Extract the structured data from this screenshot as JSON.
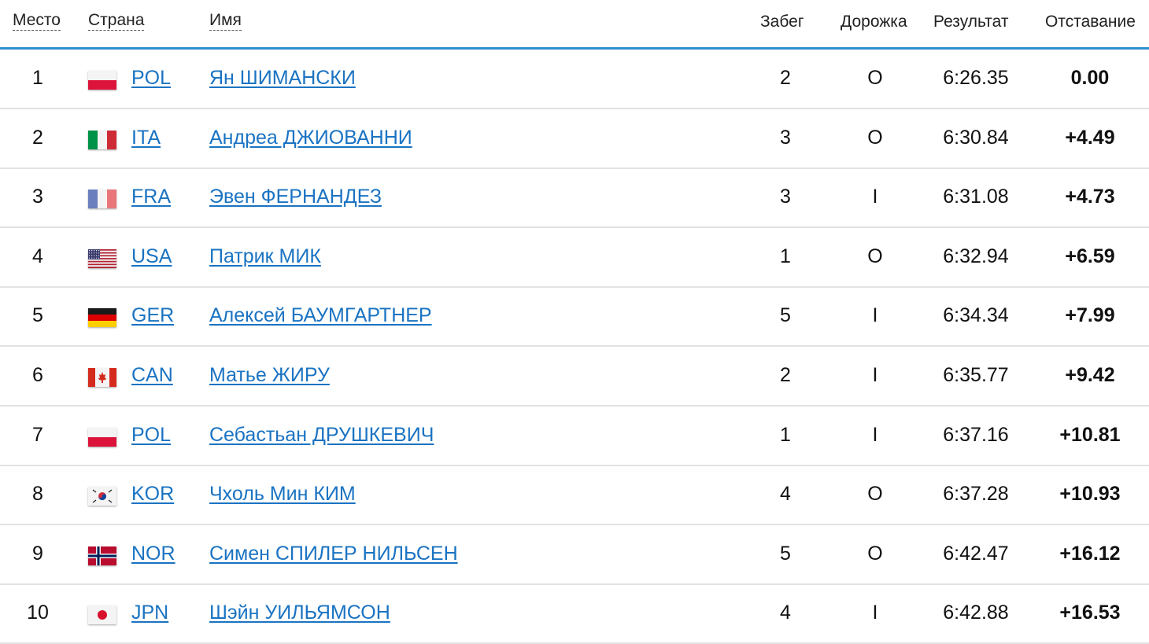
{
  "headers": {
    "place": "Место",
    "country": "Страна",
    "name": "Имя",
    "heat": "Забег",
    "lane": "Дорожка",
    "result": "Результат",
    "gap": "Отставание"
  },
  "colors": {
    "link": "#1a73c2",
    "header_rule": "#2f8fd0",
    "row_rule": "#e2e2e2"
  },
  "rows": [
    {
      "place": "1",
      "flag": "pol-flag-icon",
      "code": "POL",
      "name": "Ян ШИМАНСКИ",
      "heat": "2",
      "lane": "O",
      "result": "6:26.35",
      "gap": "0.00"
    },
    {
      "place": "2",
      "flag": "ita-flag-icon",
      "code": "ITA",
      "name": "Андреа ДЖИОВАННИ",
      "heat": "3",
      "lane": "O",
      "result": "6:30.84",
      "gap": "+4.49"
    },
    {
      "place": "3",
      "flag": "fra-flag-icon",
      "code": "FRA",
      "name": "Эвен ФЕРНАНДЕЗ",
      "heat": "3",
      "lane": "I",
      "result": "6:31.08",
      "gap": "+4.73"
    },
    {
      "place": "4",
      "flag": "usa-flag-icon",
      "code": "USA",
      "name": "Патрик МИК",
      "heat": "1",
      "lane": "O",
      "result": "6:32.94",
      "gap": "+6.59"
    },
    {
      "place": "5",
      "flag": "ger-flag-icon",
      "code": "GER",
      "name": "Алексей БАУМГАРТНЕР",
      "heat": "5",
      "lane": "I",
      "result": "6:34.34",
      "gap": "+7.99"
    },
    {
      "place": "6",
      "flag": "can-flag-icon",
      "code": "CAN",
      "name": "Матье ЖИРУ",
      "heat": "2",
      "lane": "I",
      "result": "6:35.77",
      "gap": "+9.42"
    },
    {
      "place": "7",
      "flag": "pol-flag-icon",
      "code": "POL",
      "name": "Себастьан ДРУШКЕВИЧ",
      "heat": "1",
      "lane": "I",
      "result": "6:37.16",
      "gap": "+10.81"
    },
    {
      "place": "8",
      "flag": "kor-flag-icon",
      "code": "KOR",
      "name": "Чхоль Мин КИМ",
      "heat": "4",
      "lane": "O",
      "result": "6:37.28",
      "gap": "+10.93"
    },
    {
      "place": "9",
      "flag": "nor-flag-icon",
      "code": "NOR",
      "name": "Симен СПИЛЕР НИЛЬСЕН",
      "heat": "5",
      "lane": "O",
      "result": "6:42.47",
      "gap": "+16.12"
    },
    {
      "place": "10",
      "flag": "jpn-flag-icon",
      "code": "JPN",
      "name": "Шэйн УИЛЬЯМСОН",
      "heat": "4",
      "lane": "I",
      "result": "6:42.88",
      "gap": "+16.53"
    }
  ]
}
